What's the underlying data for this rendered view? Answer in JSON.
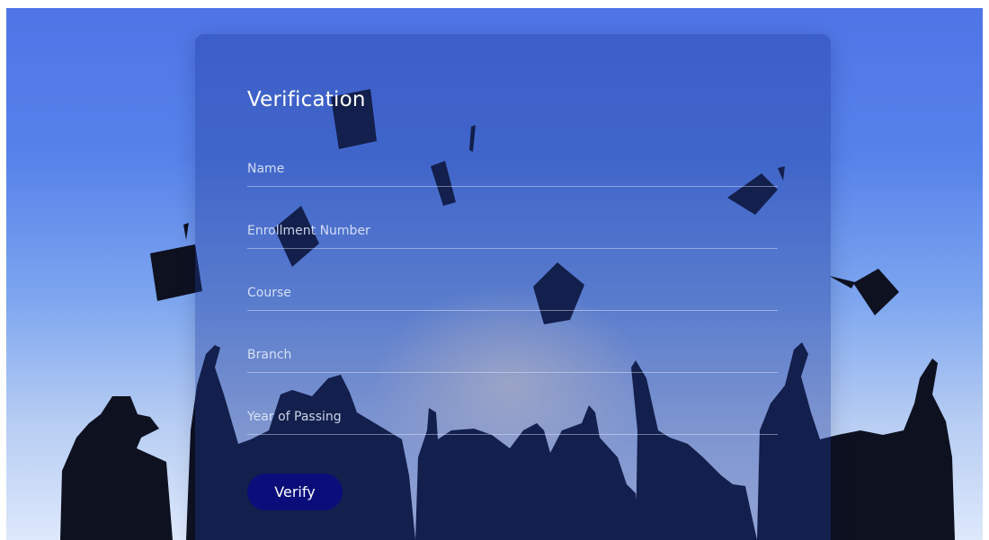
{
  "form": {
    "title": "Verification",
    "fields": [
      {
        "placeholder": "Name",
        "value": ""
      },
      {
        "placeholder": "Enrollment Number",
        "value": ""
      },
      {
        "placeholder": "Course",
        "value": ""
      },
      {
        "placeholder": "Branch",
        "value": ""
      },
      {
        "placeholder": "Year of Passing",
        "value": ""
      }
    ],
    "submit_label": "Verify"
  },
  "colors": {
    "sky_top": "#4f74e6",
    "sky_bottom": "#dde8fb",
    "card_tint": "#1c3796",
    "button": "#0a0d7a",
    "text": "#ffffff"
  }
}
